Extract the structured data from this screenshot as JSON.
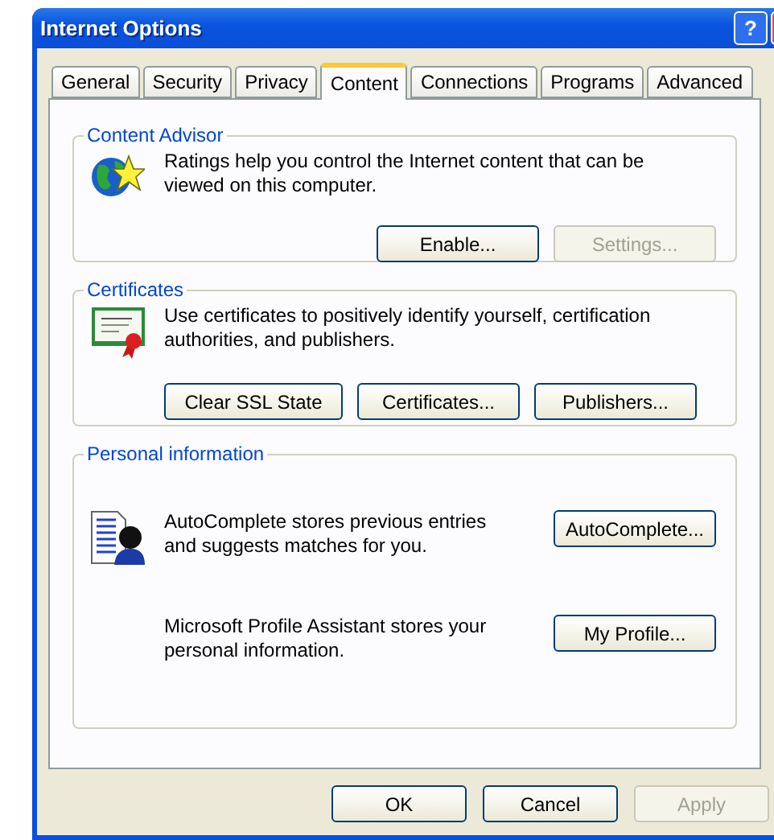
{
  "window": {
    "title": "Internet Options",
    "help_button": "?"
  },
  "tabs": [
    {
      "label": "General",
      "selected": false
    },
    {
      "label": "Security",
      "selected": false
    },
    {
      "label": "Privacy",
      "selected": false
    },
    {
      "label": "Content",
      "selected": true
    },
    {
      "label": "Connections",
      "selected": false
    },
    {
      "label": "Programs",
      "selected": false
    },
    {
      "label": "Advanced",
      "selected": false
    }
  ],
  "groups": [
    {
      "title": "Content Advisor",
      "kind": "advisor",
      "rows": [
        {
          "kind": "globe",
          "text": "Ratings help you control the Internet content that can be viewed on this computer.",
          "buttons": [
            {
              "label": "Enable...",
              "disabled": false
            },
            {
              "label": "Settings...",
              "disabled": true
            }
          ]
        }
      ]
    },
    {
      "title": "Certificates",
      "kind": "certificates",
      "rows": [
        {
          "kind": "certificate",
          "text": "Use certificates to positively identify yourself, certification authorities, and publishers.",
          "buttons": [
            {
              "label": "Clear SSL State",
              "disabled": false
            },
            {
              "label": "Certificates...",
              "disabled": false
            },
            {
              "label": "Publishers...",
              "disabled": false
            }
          ]
        }
      ]
    },
    {
      "title": "Personal information",
      "kind": "personal",
      "rows": [
        {
          "kind": "autocomplete",
          "text": "AutoComplete stores previous entries and suggests matches for you.",
          "buttons": [
            {
              "label": "AutoComplete...",
              "disabled": false
            }
          ]
        },
        {
          "kind": "plain",
          "text": "Microsoft Profile Assistant stores your personal information.",
          "buttons": [
            {
              "label": "My Profile...",
              "disabled": false
            }
          ]
        }
      ]
    }
  ],
  "buttons": [
    {
      "label": "OK",
      "disabled": false
    },
    {
      "label": "Cancel",
      "disabled": false
    },
    {
      "label": "Apply",
      "disabled": true
    }
  ]
}
